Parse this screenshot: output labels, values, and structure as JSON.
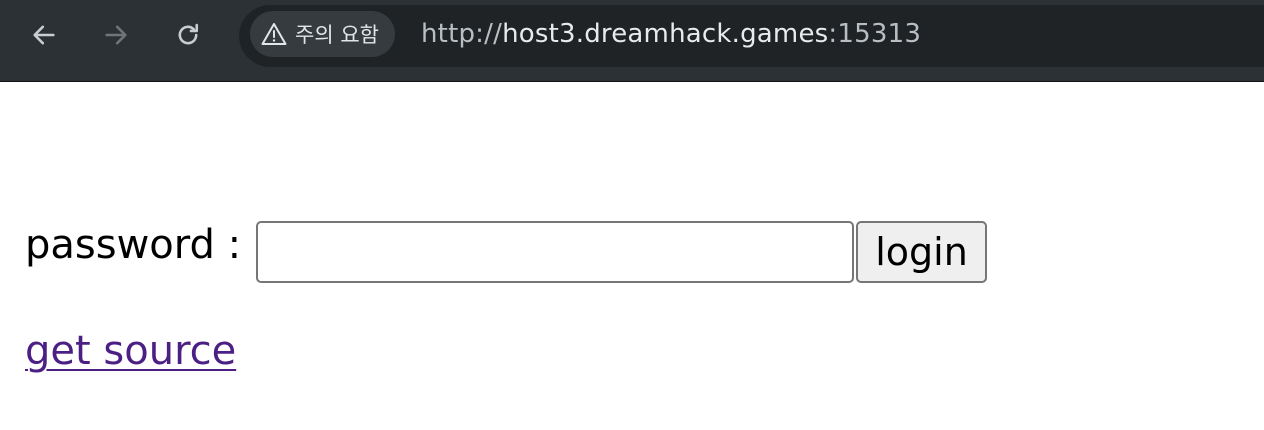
{
  "browser": {
    "security_chip_label": "주의 요함",
    "url": {
      "scheme": "http://",
      "host": "host3.dreamhack.games",
      "port": ":15313"
    },
    "icons": {
      "back": "arrow-left-icon",
      "forward": "arrow-right-icon",
      "reload": "reload-icon",
      "security": "warning-triangle-icon"
    },
    "colors": {
      "toolbar": "#2b3134",
      "omnibox": "#1f2326",
      "chip": "#353b3f"
    }
  },
  "page": {
    "password_label": "password :",
    "password_value": "",
    "login_label": "login",
    "source_link": "get source",
    "link_color": "#4c1f85"
  }
}
